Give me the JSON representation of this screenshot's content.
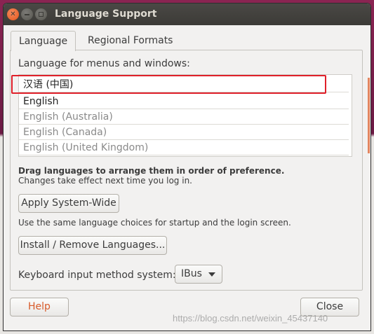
{
  "window": {
    "title": "Language Support"
  },
  "tabs": [
    {
      "label": "Language"
    },
    {
      "label": "Regional Formats"
    }
  ],
  "language": {
    "section_label": "Language for menus and windows:",
    "items": [
      {
        "label": "汉语 (中国)"
      },
      {
        "label": "English"
      },
      {
        "label": "English (Australia)"
      },
      {
        "label": "English (Canada)"
      },
      {
        "label": "English (United Kingdom)"
      }
    ],
    "hint_bold": "Drag languages to arrange them in order of preference.",
    "hint": "Changes take effect next time you log in.",
    "apply_button": "Apply System-Wide",
    "apply_note": "Use the same language choices for startup and the login screen.",
    "install_button": "Install / Remove Languages...",
    "keyboard_label": "Keyboard input method system:",
    "keyboard_value": "IBus"
  },
  "footer": {
    "help_button": "Help",
    "close_button": "Close"
  },
  "watermark": "https://blog.csdn.net/weixin_45437140",
  "colors": {
    "accent": "#e2855f",
    "highlight_box": "#e0202a",
    "titlebar": "#3c3b37"
  }
}
